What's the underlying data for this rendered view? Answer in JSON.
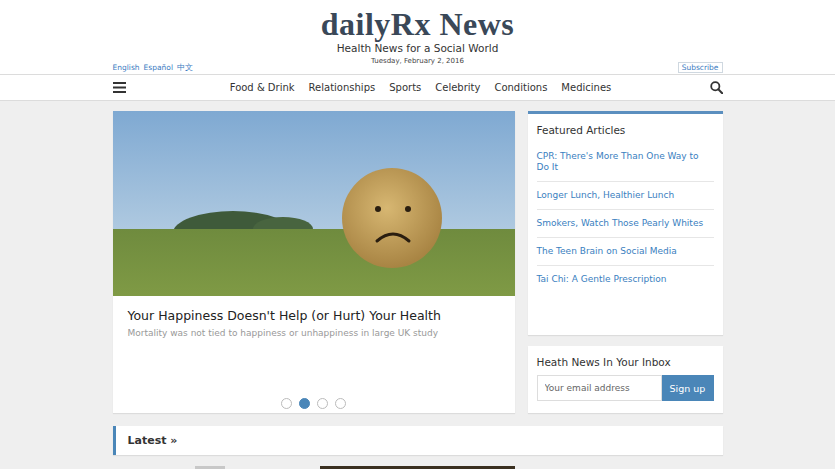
{
  "header": {
    "logo": "dailyRx News",
    "tagline": "Health News for a Social World",
    "date": "Tuesday, February 2, 2016",
    "languages": [
      "English",
      "Español",
      "中文"
    ],
    "subscribe": "Subscribe"
  },
  "nav": {
    "items": [
      "Food & Drink",
      "Relationships",
      "Sports",
      "Celebrity",
      "Conditions",
      "Medicines"
    ]
  },
  "carousel": {
    "title": "Your Happiness Doesn't Help (or Hurt) Your Health",
    "subtitle": "Mortality was not tied to happiness or unhappiness in large UK study",
    "slides": [
      {
        "selected": false
      },
      {
        "selected": true
      },
      {
        "selected": false
      },
      {
        "selected": false
      }
    ]
  },
  "featured": {
    "title": "Featured Articles",
    "items": [
      "CPR: There's More Than One Way to Do It",
      "Longer Lunch, Healthier Lunch",
      "Smokers, Watch Those Pearly Whites",
      "The Teen Brain on Social Media",
      "Tai Chi: A Gentle Prescription"
    ]
  },
  "newsletter": {
    "title": "Heath News In Your Inbox",
    "placeholder": "Your email address",
    "button": "Sign up"
  },
  "latest": {
    "title": "Latest »"
  }
}
